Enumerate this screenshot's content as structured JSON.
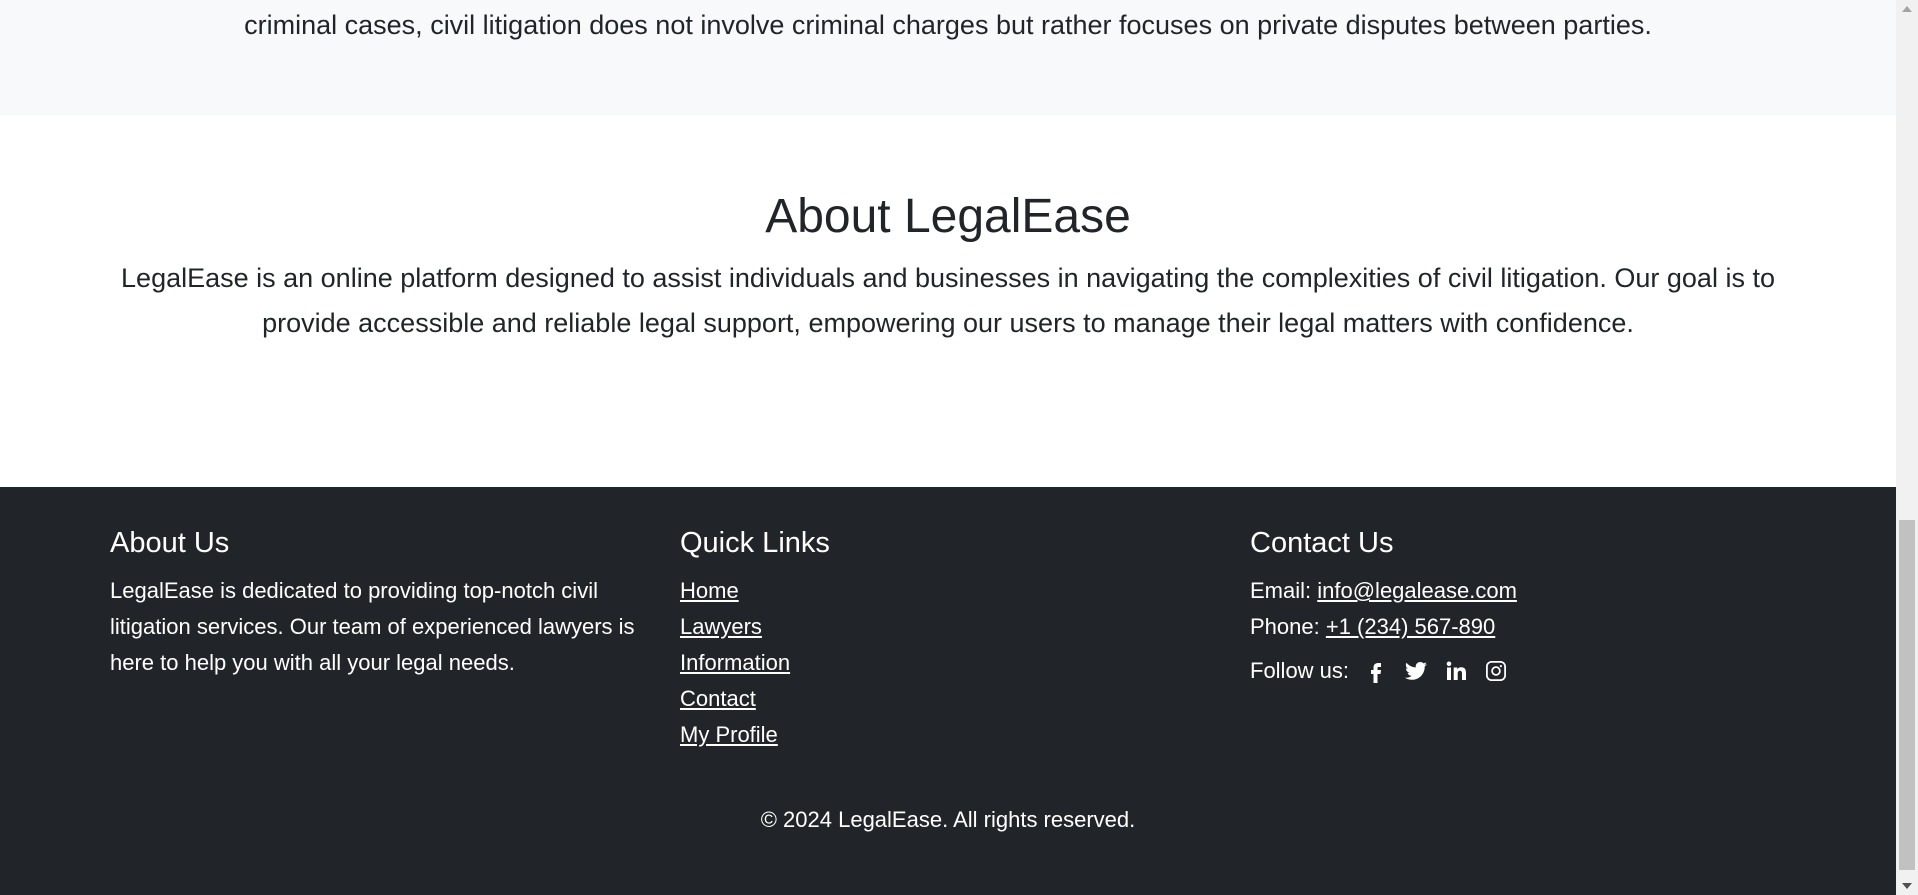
{
  "previous_section": {
    "text": "criminal cases, civil litigation does not involve criminal charges but rather focuses on private disputes between parties."
  },
  "about": {
    "title": "About LegalEase",
    "description": "LegalEase is an online platform designed to assist individuals and businesses in navigating the complexities of civil litigation. Our goal is to provide accessible and reliable legal support, empowering our users to manage their legal matters with confidence."
  },
  "footer": {
    "about_us": {
      "heading": "About Us",
      "text": "LegalEase is dedicated to providing top-notch civil litigation services. Our team of experienced lawyers is here to help you with all your legal needs."
    },
    "quick_links": {
      "heading": "Quick Links",
      "items": [
        {
          "label": "Home"
        },
        {
          "label": "Lawyers"
        },
        {
          "label": "Information"
        },
        {
          "label": "Contact"
        },
        {
          "label": "My Profile"
        }
      ]
    },
    "contact_us": {
      "heading": "Contact Us",
      "email_label": "Email:",
      "email": "info@legalease.com",
      "phone_label": "Phone:",
      "phone": "+1 (234) 567-890",
      "follow_label": "Follow us:",
      "social": [
        {
          "icon": "facebook-icon"
        },
        {
          "icon": "twitter-icon"
        },
        {
          "icon": "linkedin-icon"
        },
        {
          "icon": "instagram-icon"
        }
      ]
    },
    "copyright": "© 2024 LegalEase. All rights reserved."
  },
  "colors": {
    "footer_bg": "#212529",
    "section_alt_bg": "#f8f9fa",
    "text_dark": "#212529",
    "text_light": "#ffffff"
  }
}
